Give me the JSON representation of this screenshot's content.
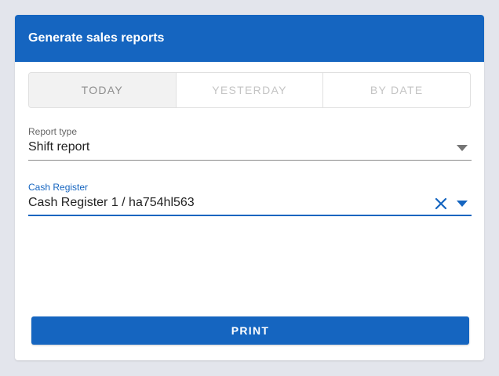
{
  "card": {
    "title": "Generate sales reports"
  },
  "period_tabs": [
    {
      "label": "TODAY",
      "active": true
    },
    {
      "label": "YESTERDAY",
      "active": false
    },
    {
      "label": "BY DATE",
      "active": false
    }
  ],
  "report_type": {
    "label": "Report type",
    "value": "Shift report",
    "icon": "dropdown-arrow-icon"
  },
  "cash_register": {
    "label": "Cash Register",
    "value": "Cash Register 1 / ha754hl563",
    "icons": [
      "clear-icon",
      "dropdown-arrow-icon"
    ]
  },
  "actions": {
    "print_label": "PRINT"
  },
  "colors": {
    "primary": "#1565c0",
    "background": "#e3e5ec",
    "inactive_tab_text": "#c4c4c4",
    "active_tab_background": "#f2f2f2"
  }
}
